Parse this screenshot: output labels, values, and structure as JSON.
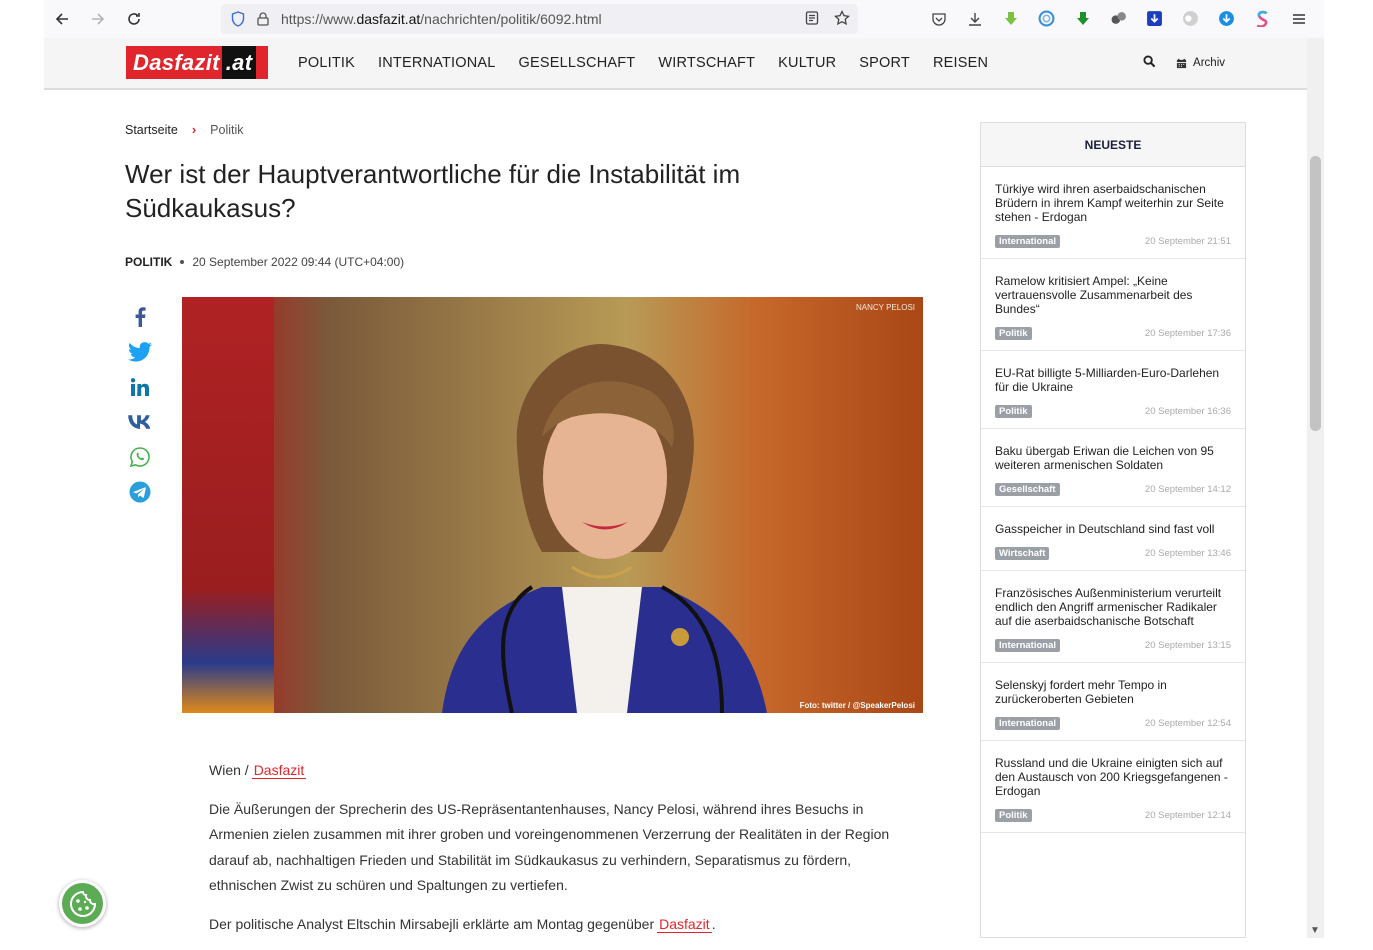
{
  "browser": {
    "url_prefix": "https://www.",
    "url_host": "dasfazit.at",
    "url_path": "/nachrichten/politik/6092.html"
  },
  "site": {
    "logo_main": "Dasfazit",
    "logo_suffix": ".at",
    "nav": [
      "POLITIK",
      "INTERNATIONAL",
      "GESELLSCHAFT",
      "WIRTSCHAFT",
      "KULTUR",
      "SPORT",
      "REISEN"
    ],
    "archive_label": "Archiv",
    "brand_color": "#e0262c"
  },
  "breadcrumb": {
    "home": "Startseite",
    "current": "Politik"
  },
  "article": {
    "title": "Wer ist der Hauptverantwortliche für die Instabilität im Südkaukasus?",
    "category": "POLITIK",
    "date": "20 September 2022 09:44 (UTC+04:00)",
    "image_watermark": "NANCY PELOSI",
    "image_credit": "Foto: twitter / @SpeakerPelosi",
    "location": "Wien /",
    "source_link": "Dasfazit",
    "paragraph1": "Die Äußerungen der Sprecherin des US-Repräsentantenhauses, Nancy Pelosi, während ihres Besuchs in Armenien zielen zusammen mit ihrer groben und voreingenommenen Verzerrung der Realitäten in der Region darauf ab, nachhaltigen Frieden und Stabilität im Südkaukasus zu verhindern, Separatismus zu fördern, ethnischen Zwist zu schüren und Spaltungen zu vertiefen.",
    "paragraph2_text": "Der politische Analyst Eltschin Mirsabejli erklärte am Montag gegenüber",
    "paragraph2_link": "Dasfazit",
    "paragraph2_end": "."
  },
  "sidebar": {
    "heading": "NEUESTE",
    "items": [
      {
        "title": "Türkiye wird ihren aserbaidschanischen Brüdern in ihrem Kampf weiterhin zur Seite stehen - Erdogan",
        "category": "International",
        "time": "20 September 21:51"
      },
      {
        "title": "Ramelow kritisiert Ampel: „Keine vertrauensvolle Zusammenarbeit des Bundes“",
        "category": "Politik",
        "time": "20 September 17:36"
      },
      {
        "title": "EU-Rat billigte 5-Milliarden-Euro-Darlehen für die Ukraine",
        "category": "Politik",
        "time": "20 September 16:36"
      },
      {
        "title": "Baku übergab Eriwan die Leichen von 95 weiteren armenischen Soldaten",
        "category": "Gesellschaft",
        "time": "20 September 14:12"
      },
      {
        "title": "Gasspeicher in Deutschland sind fast voll",
        "category": "Wirtschaft",
        "time": "20 September 13:46"
      },
      {
        "title": "Französisches Außenministerium verurteilt endlich den Angriff armenischer Radikaler auf die aserbaidschanische Botschaft",
        "category": "International",
        "time": "20 September 13:15"
      },
      {
        "title": "Selenskyj fordert mehr Tempo in zurückeroberten Gebieten",
        "category": "International",
        "time": "20 September 12:54"
      },
      {
        "title": "Russland und die Ukraine einigten sich auf den Austausch von 200 Kriegsgefangenen - Erdogan",
        "category": "Politik",
        "time": "20 September 12:14"
      }
    ]
  }
}
